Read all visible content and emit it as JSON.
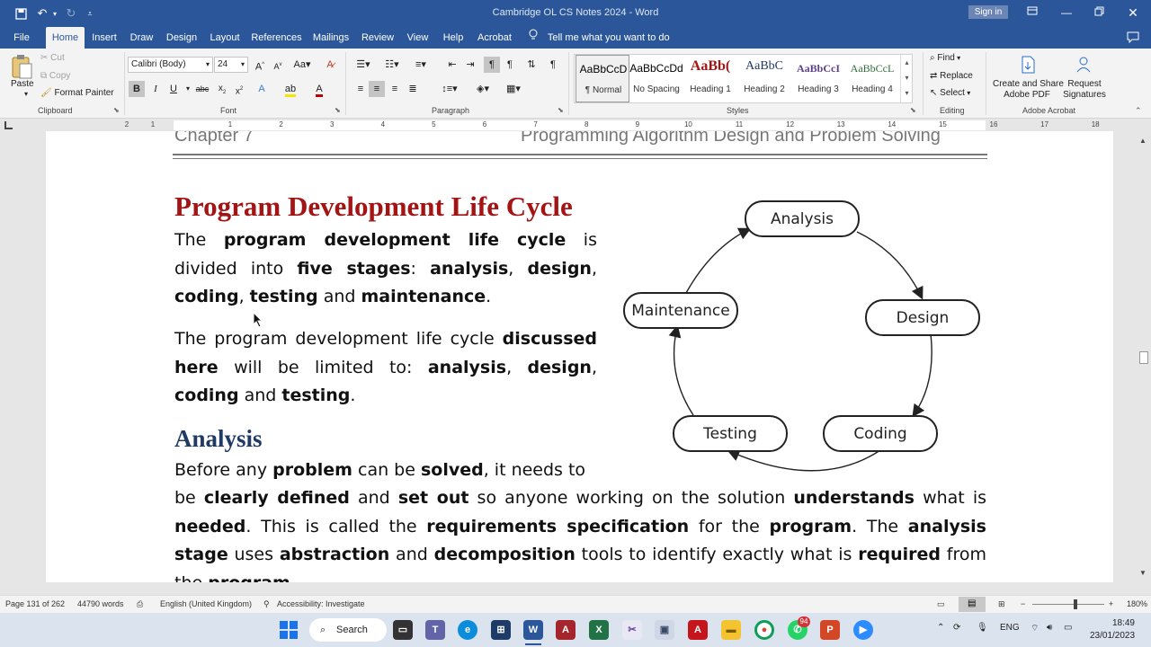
{
  "window": {
    "title": "Cambridge OL CS Notes 2024  -  Word",
    "sign_in": "Sign in"
  },
  "menu": {
    "tabs": [
      "File",
      "Home",
      "Insert",
      "Draw",
      "Design",
      "Layout",
      "References",
      "Mailings",
      "Review",
      "View",
      "Help",
      "Acrobat"
    ],
    "active_tab": "Home",
    "tell_me": "Tell me what you want to do"
  },
  "ribbon": {
    "clipboard": {
      "paste": "Paste",
      "cut": "Cut",
      "copy": "Copy",
      "format_painter": "Format Painter",
      "label": "Clipboard"
    },
    "font": {
      "name": "Calibri (Body)",
      "size": "24",
      "label": "Font"
    },
    "paragraph": {
      "label": "Paragraph"
    },
    "styles": {
      "label": "Styles",
      "items": [
        {
          "sample": "AaBbCcD",
          "name": "¶ Normal",
          "color": "#000000"
        },
        {
          "sample": "AaBbCcDd",
          "name": "No Spacing",
          "color": "#000000"
        },
        {
          "sample": "AaBb(",
          "name": "Heading 1",
          "color": "#a31515"
        },
        {
          "sample": "AaBbC",
          "name": "Heading 2",
          "color": "#1f3a64"
        },
        {
          "sample": "AaBbCcI",
          "name": "Heading 3",
          "color": "#5b3f8c"
        },
        {
          "sample": "AaBbCcL",
          "name": "Heading 4",
          "color": "#2f6e3a"
        }
      ]
    },
    "editing": {
      "find": "Find",
      "replace": "Replace",
      "select": "Select",
      "label": "Editing"
    },
    "acrobat": {
      "create_share": "Create and Share",
      "adobe_pdf": "Adobe PDF",
      "request": "Request",
      "signatures": "Signatures",
      "label": "Adobe Acrobat"
    }
  },
  "ruler": {
    "numbers": [
      "2",
      "1",
      "1",
      "2",
      "3",
      "4",
      "5",
      "6",
      "7",
      "8",
      "9",
      "10",
      "11",
      "12",
      "13",
      "14",
      "15",
      "16",
      "17",
      "18"
    ]
  },
  "document": {
    "header_left": "Chapter 7",
    "header_right": "Programming  Algorithm Design and Problem Solving",
    "heading1": "Program Development Life Cycle",
    "heading2": "Analysis",
    "diagram": {
      "stages": [
        "Analysis",
        "Design",
        "Coding",
        "Testing",
        "Maintenance"
      ]
    }
  },
  "statusbar": {
    "page": "Page 131 of 262",
    "words": "44790 words",
    "language": "English (United Kingdom)",
    "accessibility": "Accessibility: Investigate",
    "zoom": "180%"
  },
  "taskbar": {
    "search": "Search",
    "lang": "ENG",
    "time": "18:49",
    "date": "23/01/2023",
    "badge": "94"
  }
}
